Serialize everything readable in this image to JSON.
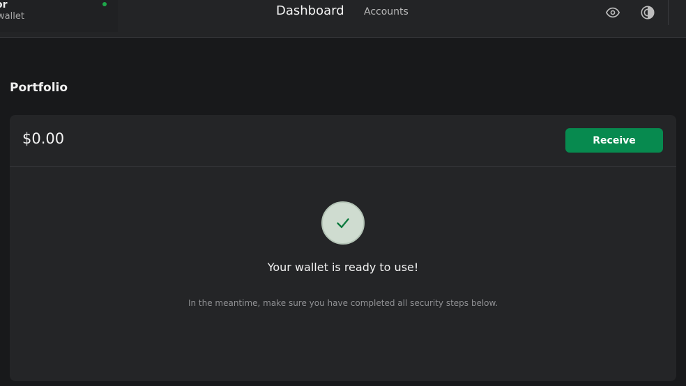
{
  "topbar": {
    "device_name": "or",
    "device_sub": "wallet",
    "nav": {
      "dashboard": "Dashboard",
      "accounts": "Accounts"
    },
    "icons": {
      "eye": "eye-icon",
      "theme": "theme-toggle-icon"
    },
    "status_color": "#1ea84a"
  },
  "page": {
    "title": "Portfolio"
  },
  "portfolio": {
    "balance": "$0.00",
    "receive_label": "Receive",
    "accent_color": "#078a4f",
    "ready_title": "Your wallet is ready to use!",
    "ready_subtitle": "In the meantime, make sure you have completed all security steps below.",
    "check_icon": "check-icon"
  }
}
